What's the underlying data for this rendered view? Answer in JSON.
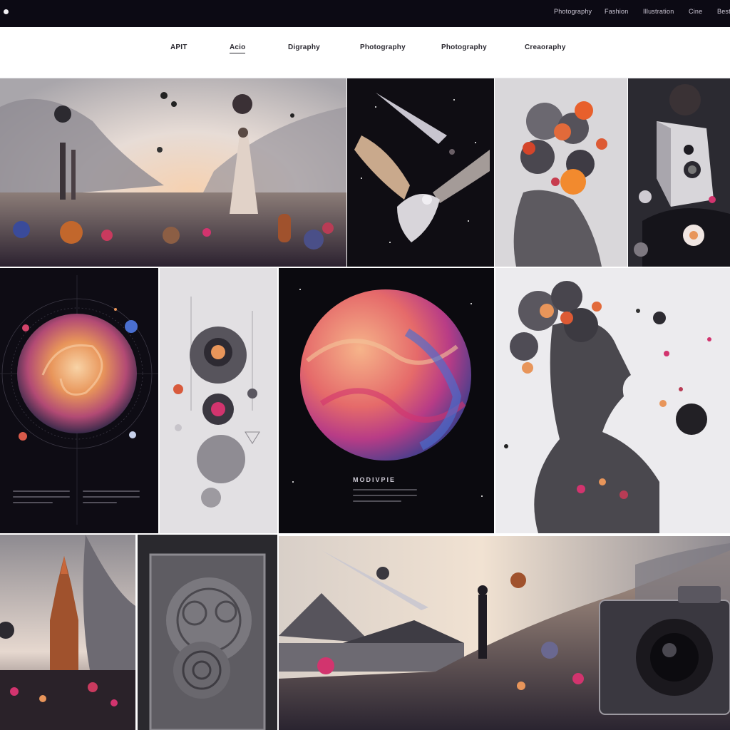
{
  "topbar": {
    "links": [
      "Photography",
      "Fashion",
      "Illustration",
      "Cine",
      "Best"
    ]
  },
  "nav": {
    "categories": [
      "APIT",
      "Acio",
      "Digraphy",
      "Photography",
      "Photography",
      "Creaoraphy"
    ],
    "active_index": 1
  },
  "tiles": {
    "poster_caption": "MODIVPIE"
  },
  "colors": {
    "topbar_bg": "#0c0a14",
    "nav_bg": "#ffffff",
    "accent_warm": "#e8955a",
    "accent_pink": "#d2346e",
    "accent_blue": "#4a6fd0"
  },
  "icons": {
    "logo": "logo-dot-icon"
  }
}
